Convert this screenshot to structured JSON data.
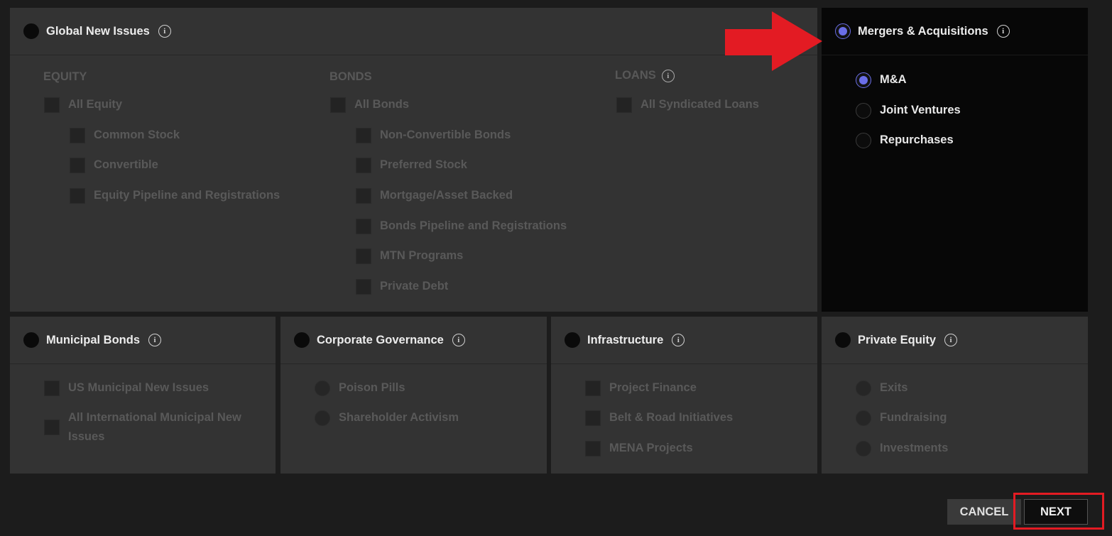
{
  "panels": {
    "global_new_issues": {
      "title": "Global New Issues",
      "categories": {
        "equity": {
          "title": "EQUITY",
          "items": [
            "All Equity",
            "Common Stock",
            "Convertible",
            "Equity Pipeline and Registrations"
          ]
        },
        "bonds": {
          "title": "BONDS",
          "items": [
            "All Bonds",
            "Non-Convertible Bonds",
            "Preferred Stock",
            "Mortgage/Asset Backed",
            "Bonds Pipeline and Registrations",
            "MTN Programs",
            "Private Debt"
          ]
        },
        "loans": {
          "title": "LOANS",
          "items": [
            "All Syndicated Loans"
          ]
        }
      }
    },
    "mergers_acquisitions": {
      "title": "Mergers & Acquisitions",
      "items": [
        "M&A",
        "Joint Ventures",
        "Repurchases"
      ],
      "selected_item": "M&A"
    },
    "municipal_bonds": {
      "title": "Municipal Bonds",
      "items": [
        "US Municipal New Issues",
        "All International Municipal New Issues"
      ]
    },
    "corporate_governance": {
      "title": "Corporate Governance",
      "items": [
        "Poison Pills",
        "Shareholder Activism"
      ]
    },
    "infrastructure": {
      "title": "Infrastructure",
      "items": [
        "Project Finance",
        "Belt & Road Initiatives",
        "MENA Projects"
      ]
    },
    "private_equity": {
      "title": "Private Equity",
      "items": [
        "Exits",
        "Fundraising",
        "Investments"
      ]
    }
  },
  "buttons": {
    "cancel": "CANCEL",
    "next": "NEXT"
  },
  "annotations": {
    "arrow_color": "#e31b23",
    "highlight_color": "#e31b23"
  },
  "colors": {
    "accent": "#6a6ee8",
    "background": "#1c1c1c",
    "panel": "#333333",
    "selected_panel": "#070707"
  }
}
